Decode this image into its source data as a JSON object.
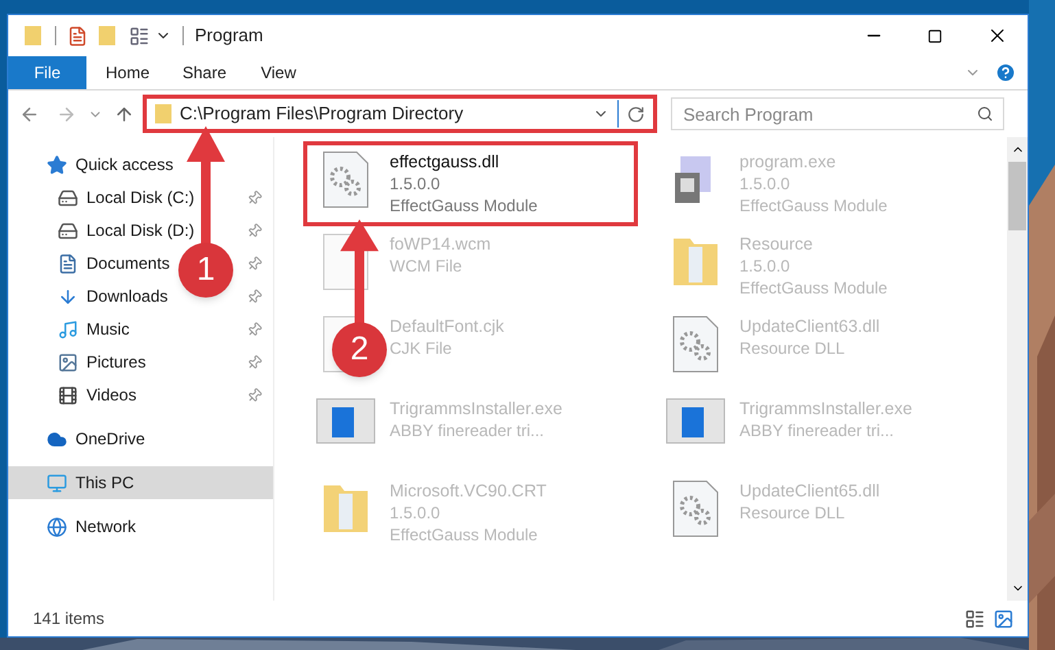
{
  "window": {
    "title": "Program"
  },
  "ribbon_tabs": [
    {
      "label": "File",
      "selected": true
    },
    {
      "label": "Home",
      "selected": false
    },
    {
      "label": "Share",
      "selected": false
    },
    {
      "label": "View",
      "selected": false
    }
  ],
  "address": {
    "value": "C:\\Program Files\\Program Directory",
    "highlighted": true
  },
  "search": {
    "placeholder": "Search Program"
  },
  "sidebar": {
    "items": [
      {
        "label": "Quick access",
        "kind": "star",
        "selected": false,
        "children": [
          {
            "label": "Local Disk (C:)",
            "kind": "disk-c",
            "pinned": true,
            "selected": false
          },
          {
            "label": "Local Disk (D:)",
            "kind": "disk",
            "pinned": true,
            "selected": false
          },
          {
            "label": "Documents",
            "kind": "doc",
            "pinned": true,
            "selected": false
          },
          {
            "label": "Downloads",
            "kind": "download",
            "pinned": true,
            "selected": false
          },
          {
            "label": "Music",
            "kind": "music",
            "pinned": true,
            "selected": false
          },
          {
            "label": "Pictures",
            "kind": "pictures",
            "pinned": true,
            "selected": false
          },
          {
            "label": "Videos",
            "kind": "videos",
            "pinned": true,
            "selected": false
          }
        ]
      },
      {
        "label": "OneDrive",
        "kind": "cloud",
        "selected": false
      },
      {
        "label": "This PC",
        "kind": "pc",
        "selected": true
      },
      {
        "label": "Network",
        "kind": "network",
        "selected": false
      }
    ]
  },
  "files": [
    {
      "name": "effectgauss.dll",
      "lines": [
        "1.5.0.0",
        "EffectGauss Module"
      ],
      "kind": "gear-file",
      "highlighted": true,
      "blurred": false
    },
    {
      "name": "program.exe",
      "lines": [
        "1.5.0.0",
        "EffectGauss Module"
      ],
      "kind": "exe",
      "highlighted": false,
      "blurred": true
    },
    {
      "name": "foWP14.wcm",
      "lines": [
        "WCM File"
      ],
      "kind": "blank-file",
      "highlighted": false,
      "blurred": true
    },
    {
      "name": "Resource",
      "lines": [
        "1.5.0.0",
        "EffectGauss Module"
      ],
      "kind": "folder",
      "highlighted": false,
      "blurred": true
    },
    {
      "name": "DefaultFont.cjk",
      "lines": [
        "CJK File"
      ],
      "kind": "blank-file",
      "highlighted": false,
      "blurred": true
    },
    {
      "name": "UpdateClient63.dll",
      "lines": [
        "Resource DLL"
      ],
      "kind": "gear-file",
      "highlighted": false,
      "blurred": true
    },
    {
      "name": "TrigrammsInstaller.exe",
      "lines": [
        "ABBY finereader tri..."
      ],
      "kind": "installer",
      "highlighted": false,
      "blurred": true
    },
    {
      "name": "TrigrammsInstaller.exe",
      "lines": [
        "ABBY finereader tri..."
      ],
      "kind": "installer",
      "highlighted": false,
      "blurred": true
    },
    {
      "name": "Microsoft.VC90.CRT",
      "lines": [
        "1.5.0.0",
        "EffectGauss Module"
      ],
      "kind": "folder",
      "highlighted": false,
      "blurred": true
    },
    {
      "name": "UpdateClient65.dll",
      "lines": [
        "Resource DLL"
      ],
      "kind": "gear-file",
      "highlighted": false,
      "blurred": true
    }
  ],
  "status_bar": {
    "count": "141 items"
  },
  "annotations": [
    {
      "number": "1"
    },
    {
      "number": "2"
    }
  ]
}
